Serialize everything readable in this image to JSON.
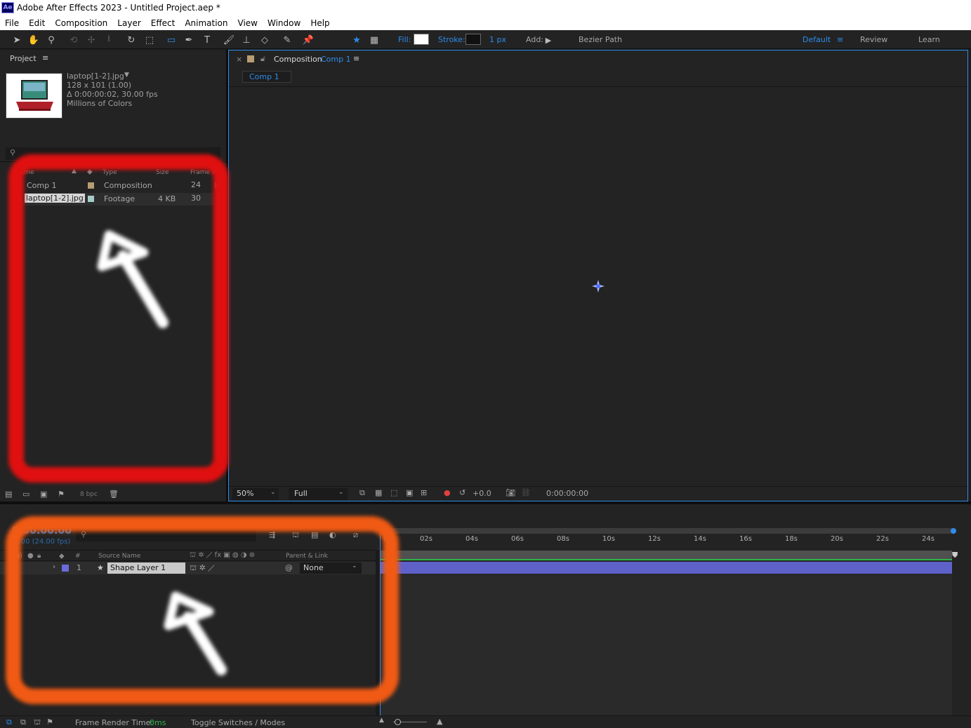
{
  "window": {
    "title": "Adobe After Effects 2023 - Untitled Project.aep *",
    "app_badge": "Ae"
  },
  "menu": [
    "File",
    "Edit",
    "Composition",
    "Layer",
    "Effect",
    "Animation",
    "View",
    "Window",
    "Help"
  ],
  "toolbar": {
    "fill_label": "Fill:",
    "stroke_label": "Stroke:",
    "stroke_width": "1 px",
    "add_label": "Add:",
    "bezier_label": "Bezier Path",
    "workspaces": [
      "Default",
      "Review",
      "Learn"
    ],
    "fill_color": "#ffffff",
    "stroke_color": "#111111",
    "accent_color": "#2d8ceb"
  },
  "project": {
    "tab_label": "Project",
    "menu_icon": "≡",
    "footage": {
      "name": "laptop[1-2].jpg",
      "dims": "128 x 101 (1.00)",
      "duration": "Δ 0:00:00:02, 30.00 fps",
      "colors": "Millions of Colors"
    },
    "columns": [
      "Name",
      "Type",
      "Size",
      "Frame R..."
    ],
    "rows": [
      {
        "name": "Comp 1",
        "type": "Composition",
        "size": "",
        "frame_rate": "24",
        "label_color": "#b89d73"
      },
      {
        "name": "laptop[1-2].jpg",
        "type": "Footage",
        "size": "4 KB",
        "frame_rate": "30",
        "label_color": "#a5cbc9"
      }
    ],
    "bpc": "8 bpc"
  },
  "composition": {
    "tab_prefix": "Composition",
    "tab_name": "Comp 1",
    "subtab": "Comp 1",
    "zoom": "50%",
    "resolution": "Full",
    "exposure": "+0.0",
    "timecode": "0:00:00:00"
  },
  "timeline": {
    "timecode": "0:00:00:00",
    "fps": "0000 (24.00 fps)",
    "columns": {
      "source_name": "Source Name",
      "parent": "Parent & Link",
      "hash": "#"
    },
    "layers": [
      {
        "index": "1",
        "name": "Shape Layer 1",
        "parent": "None",
        "label_color": "#6b6bdb"
      }
    ],
    "ruler": [
      "0s",
      "02s",
      "04s",
      "06s",
      "08s",
      "10s",
      "12s",
      "14s",
      "16s",
      "18s",
      "20s",
      "22s",
      "24s"
    ],
    "footer": {
      "render_label": "Frame Render Time:",
      "render_value": "0ms",
      "toggle_label": "Toggle Switches / Modes"
    }
  },
  "annotations": {
    "red": "#e01010",
    "orange": "#f05a14"
  }
}
